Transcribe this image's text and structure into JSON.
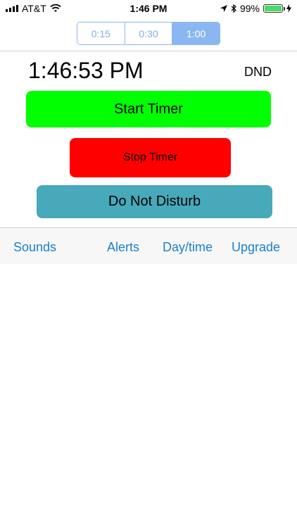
{
  "status_bar": {
    "carrier": "AT&T",
    "time": "1:46 PM",
    "battery_percent": "99%",
    "battery_level": 0.99,
    "icons": [
      "signal-icon",
      "wifi-icon",
      "location-icon",
      "bluetooth-icon",
      "battery-icon",
      "charging-icon"
    ]
  },
  "interval_selector": {
    "options": [
      "0:15",
      "0:30",
      "1:00"
    ],
    "selected": "1:00"
  },
  "clock": {
    "time": "1:46:53 PM"
  },
  "dnd_label": "DND",
  "buttons": {
    "start": "Start Timer",
    "stop": "Stop Timer",
    "dnd": "Do Not Disturb"
  },
  "colors": {
    "start": "#00ff00",
    "stop": "#ff0000",
    "dnd": "#47a9ba",
    "accent": "#1a7fd0",
    "segment": "#8ab7f2"
  },
  "tabbar": {
    "items": [
      "Sounds",
      "Alerts",
      "Day/time",
      "Upgrade"
    ]
  }
}
